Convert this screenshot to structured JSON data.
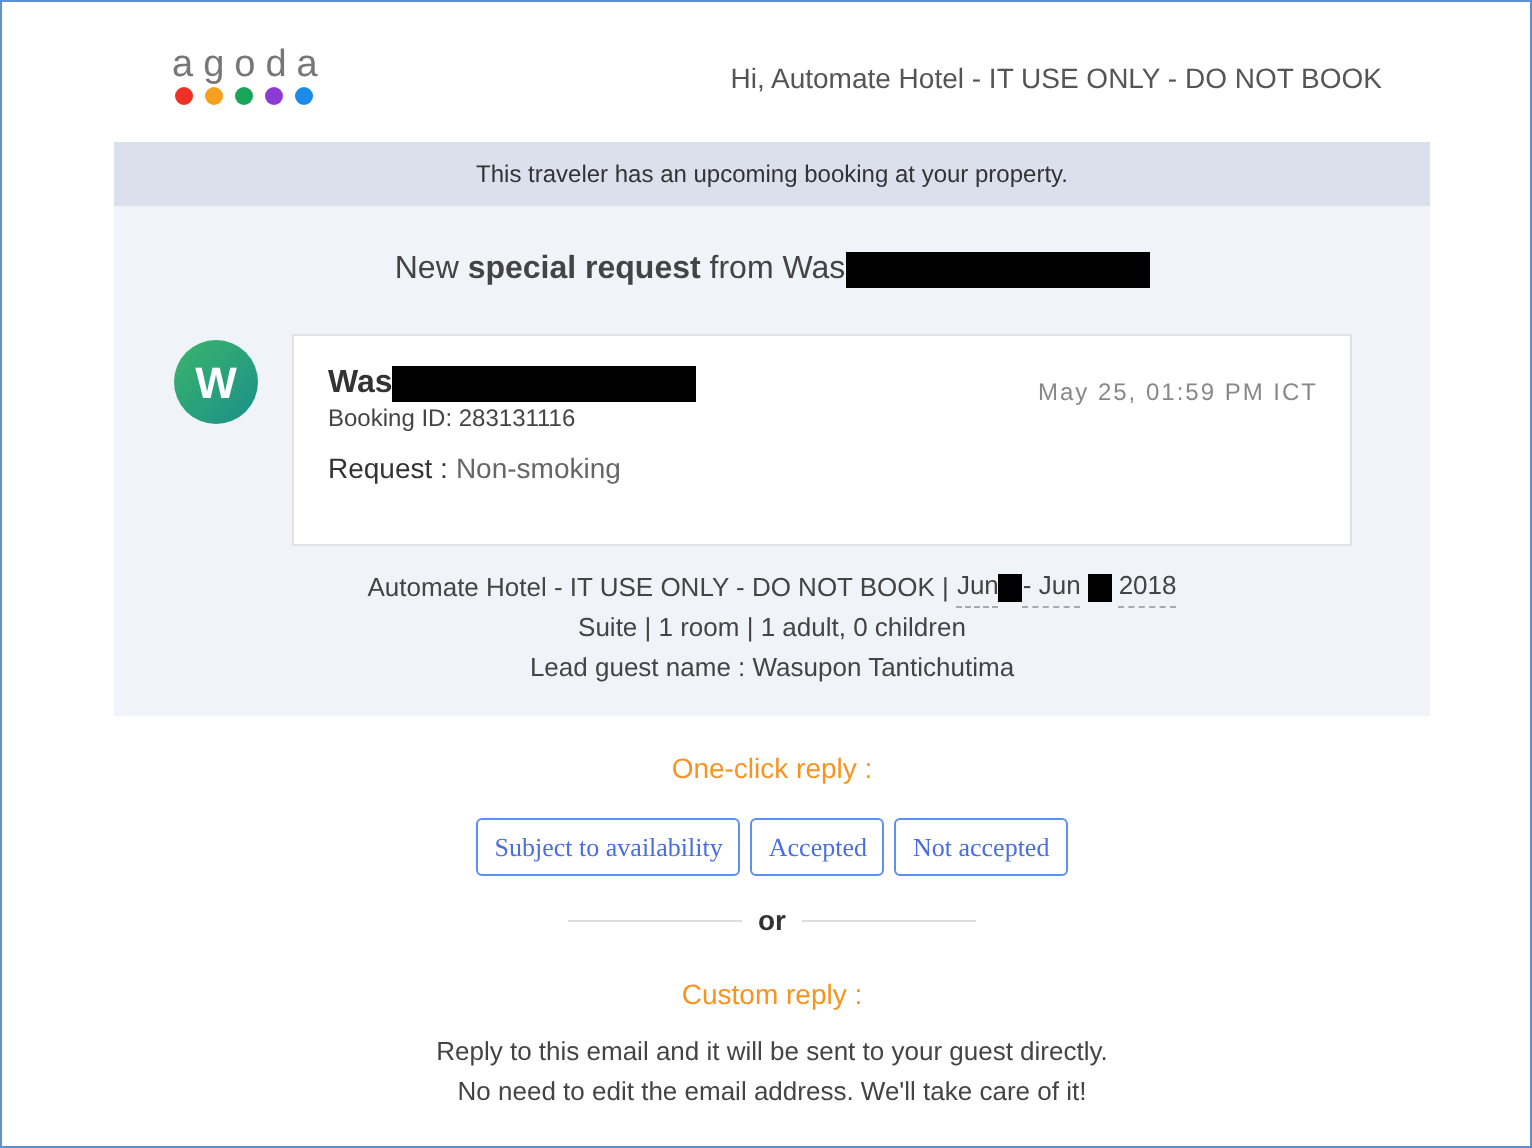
{
  "logo": {
    "text": "agoda"
  },
  "greeting": "Hi, Automate Hotel - IT USE ONLY - DO NOT BOOK",
  "banner": "This traveler has an upcoming booking at your property.",
  "heading": "New **special request** from Was",
  "message": {
    "avatar": "W",
    "guest_name": "Was",
    "booking_id": "Booking ID: 283131116",
    "time": "May 25, 01:59 PM ICT",
    "request_label": "Request :",
    "request_value": "Non-smoking"
  },
  "booking": {
    "property": "Automate Hotel - IT USE ONLY - DO NOT BOOK |",
    "date_parts": [
      "Jun",
      "- Jun",
      "2018"
    ],
    "room": "Suite | 1 room | 1 adult, 0 children",
    "lead_guest": "Lead guest name : Wasupon Tantichutima"
  },
  "one_click": {
    "title": "One-click reply :",
    "buttons": [
      "Subject to availability",
      "Accepted",
      "Not accepted"
    ]
  },
  "divider": "or",
  "custom": {
    "title": "Custom reply :",
    "lines": [
      "Reply to this email and it will be sent to your guest directly.",
      "No need to edit the email address. We'll take care of it!"
    ]
  }
}
